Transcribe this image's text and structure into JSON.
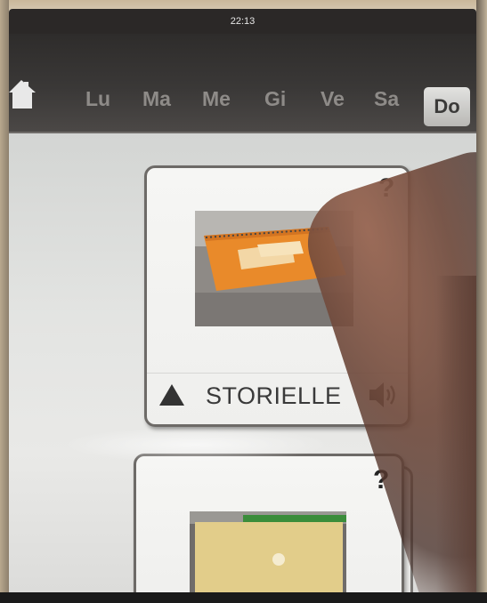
{
  "status_bar": {
    "time": "22:13"
  },
  "nav": {
    "home_icon": "home-icon",
    "days": [
      "Lu",
      "Ma",
      "Me",
      "Gi",
      "Ve",
      "Sa"
    ],
    "active_day": "Do"
  },
  "cards": [
    {
      "help": "?",
      "label": "STORIELLE",
      "icons": [
        "up-arrow-icon",
        "speaker-icon"
      ]
    },
    {
      "help": "?"
    }
  ],
  "colors": {
    "nav_bg": "#3a3837",
    "day_text": "#8e8b88",
    "active_day_bg": "#d0d0ce",
    "card_border": "#6d6a67",
    "content_bg": "#e3e4e2"
  }
}
